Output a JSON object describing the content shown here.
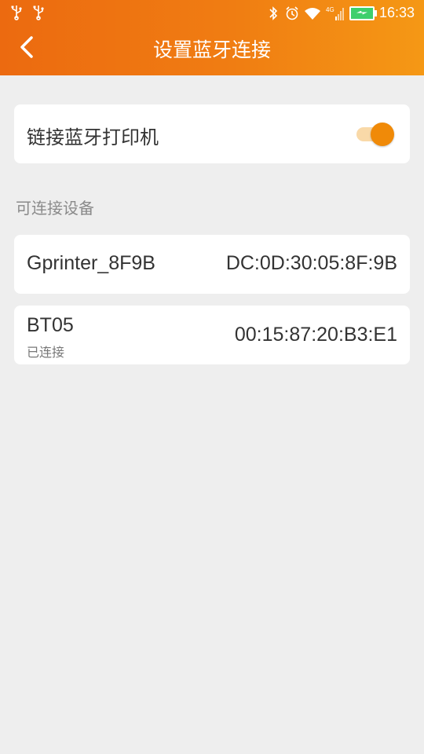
{
  "status_bar": {
    "time": "16:33",
    "icons": [
      "usb-icon",
      "usb-icon",
      "bluetooth-icon",
      "alarm-icon",
      "wifi-icon",
      "signal-icon",
      "battery-icon"
    ],
    "signal_label": "4G"
  },
  "header": {
    "back_icon": "chevron-left-icon",
    "title": "设置蓝牙连接",
    "gradient_start": "#ec6a10",
    "gradient_end": "#f59815"
  },
  "printer_toggle": {
    "label": "链接蓝牙打印机",
    "enabled": true,
    "accent_color": "#f08a08"
  },
  "devices_section": {
    "title": "可连接设备",
    "devices": [
      {
        "name": "Gprinter_8F9B",
        "mac": "DC:0D:30:05:8F:9B",
        "status": ""
      },
      {
        "name": "BT05",
        "mac": "00:15:87:20:B3:E1",
        "status": "已连接"
      }
    ]
  }
}
